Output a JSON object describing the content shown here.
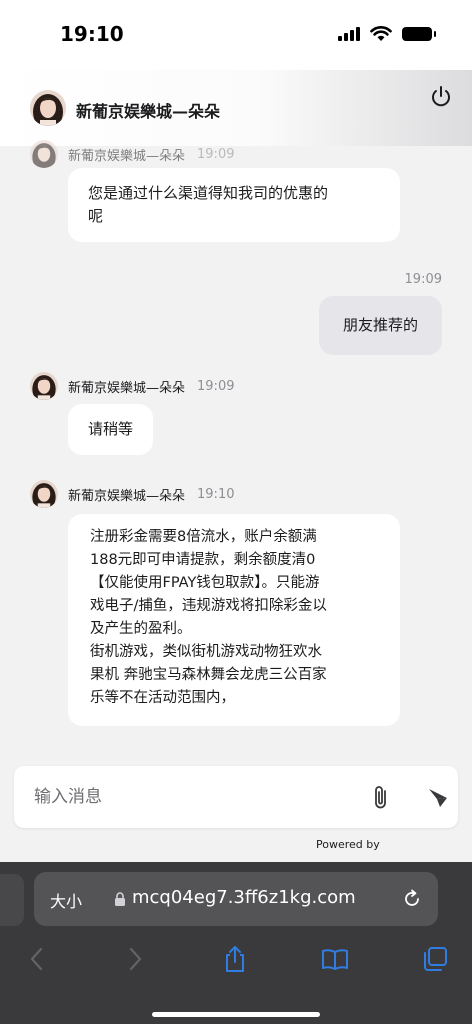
{
  "status_bar": {
    "time": "19:10"
  },
  "header": {
    "title": "新葡京娱樂城—朵朵"
  },
  "messages": {
    "partial": {
      "sender": "新葡京娱樂城—朵朵",
      "time": "19:09"
    },
    "m1": {
      "text": "您是通过什么渠道得知我司的优惠的\n呢"
    },
    "m2": {
      "time": "19:09",
      "text": "朋友推荐的"
    },
    "m3": {
      "sender": "新葡京娱樂城—朵朵",
      "time": "19:09",
      "text": "请稍等"
    },
    "m4": {
      "sender": "新葡京娱樂城—朵朵",
      "time": "19:10",
      "text": "注册彩金需要8倍流水，账户余额满\n188元即可申请提款，剩余额度清0\n【仅能使用FPAY钱包取款】。只能游\n戏电子/捕鱼，违规游戏将扣除彩金以\n及产生的盈利。\n街机游戏，类似街机游戏动物狂欢水\n果机 奔驰宝马森林舞会龙虎三公百家\n乐等不在活动范围内，"
    }
  },
  "input": {
    "placeholder": "输入消息"
  },
  "footer": {
    "powered_by": "Powered by"
  },
  "browser": {
    "aa_label": "大小",
    "url": "mcq04eg7.3ff6z1kg.com"
  },
  "colors": {
    "accent": "#2f7de1",
    "bubble_out": "#e5e5ea",
    "bubble_in": "#ffffff"
  },
  "icons": [
    "power-icon",
    "paperclip-icon",
    "send-icon",
    "lock-icon",
    "reload-icon",
    "back-icon",
    "forward-icon",
    "share-icon",
    "bookmarks-icon",
    "tabs-icon"
  ]
}
